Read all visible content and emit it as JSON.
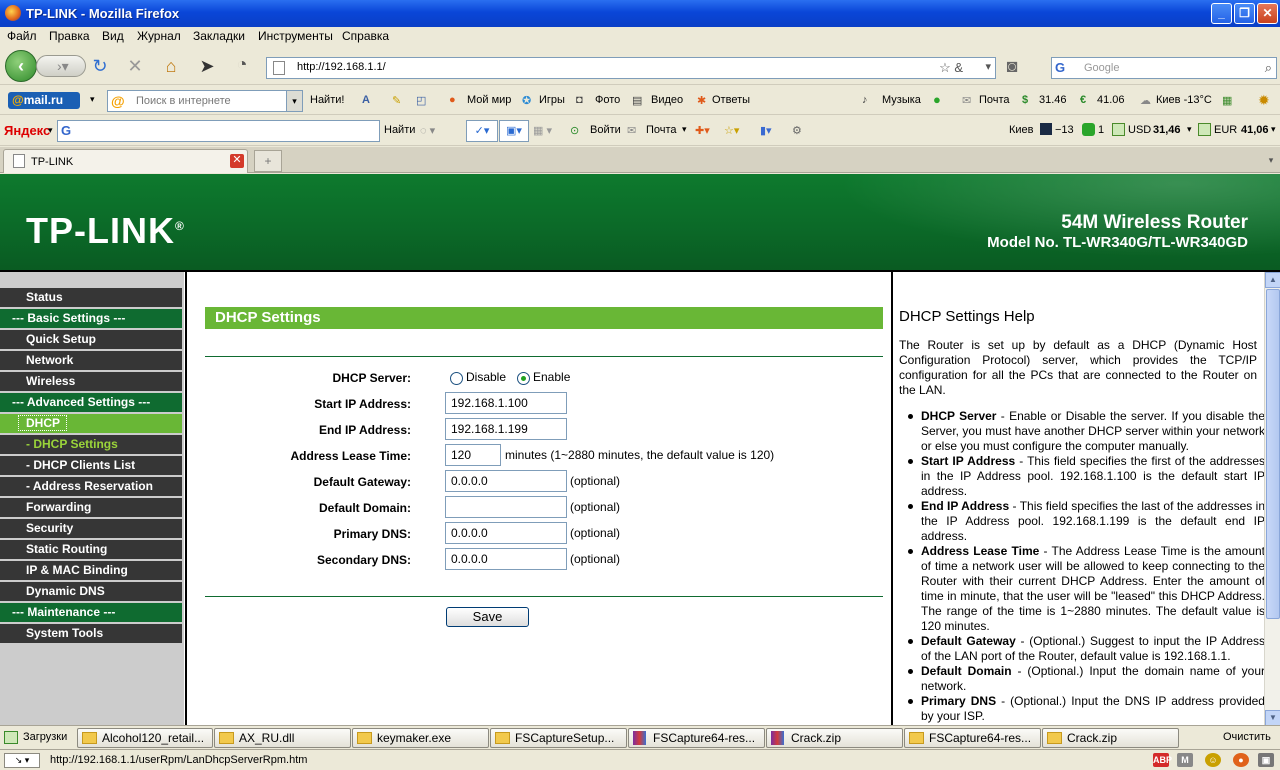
{
  "window": {
    "title": "TP-LINK - Mozilla Firefox"
  },
  "menubar": [
    "Файл",
    "Правка",
    "Вид",
    "Журнал",
    "Закладки",
    "Инструменты",
    "Справка"
  ],
  "nav": {
    "url": "http://192.168.1.1/",
    "search_placeholder": "Google"
  },
  "mailbar": {
    "logo": "mail.ru",
    "search_placeholder": "Поиск в интернете",
    "find": "Найти!",
    "links": [
      "Мой мир",
      "Игры",
      "Фото",
      "Видео",
      "Ответы",
      "Музыка",
      "Почта",
      "31.46",
      "41.06",
      "Киев -13°C"
    ]
  },
  "yabar": {
    "logo": "Яндекс",
    "find": "Найти",
    "login": "Войти",
    "mail": "Почта",
    "city": "Киев",
    "temp": "−13",
    "count": "1",
    "usd_label": "USD",
    "usd": "31,46",
    "eur_label": "EUR",
    "eur": "41,06"
  },
  "tab": {
    "label": "TP-LINK"
  },
  "banner": {
    "logo": "TP-LINK",
    "product": "54M Wireless Router",
    "model": "Model No. TL-WR340G/TL-WR340GD"
  },
  "sidebar": {
    "items": [
      {
        "label": "Status",
        "kind": "dark"
      },
      {
        "label": "--- Basic Settings ---",
        "kind": "sec"
      },
      {
        "label": "Quick Setup",
        "kind": "dark"
      },
      {
        "label": "Network",
        "kind": "dark"
      },
      {
        "label": "Wireless",
        "kind": "dark"
      },
      {
        "label": "--- Advanced Settings ---",
        "kind": "sec"
      },
      {
        "label": "DHCP",
        "kind": "sel"
      },
      {
        "label": "- DHCP Settings",
        "kind": "subsel"
      },
      {
        "label": "- DHCP Clients List",
        "kind": "sub"
      },
      {
        "label": "- Address Reservation",
        "kind": "sub"
      },
      {
        "label": "Forwarding",
        "kind": "dark"
      },
      {
        "label": "Security",
        "kind": "dark"
      },
      {
        "label": "Static Routing",
        "kind": "dark"
      },
      {
        "label": "IP & MAC Binding",
        "kind": "dark"
      },
      {
        "label": "Dynamic DNS",
        "kind": "dark"
      },
      {
        "label": "--- Maintenance ---",
        "kind": "sec"
      },
      {
        "label": "System Tools",
        "kind": "dark"
      }
    ]
  },
  "form": {
    "title": "DHCP Settings",
    "server_label": "DHCP Server:",
    "disable": "Disable",
    "enable": "Enable",
    "start_label": "Start IP Address:",
    "start_value": "192.168.1.100",
    "end_label": "End IP Address:",
    "end_value": "192.168.1.199",
    "lease_label": "Address Lease Time:",
    "lease_value": "120",
    "lease_hint": "minutes (1~2880 minutes, the default value is 120)",
    "gateway_label": "Default Gateway:",
    "gateway_value": "0.0.0.0",
    "domain_label": "Default Domain:",
    "domain_value": "",
    "pdns_label": "Primary DNS:",
    "pdns_value": "0.0.0.0",
    "sdns_label": "Secondary DNS:",
    "sdns_value": "0.0.0.0",
    "optional": "(optional)",
    "save": "Save"
  },
  "help": {
    "title": "DHCP Settings Help",
    "intro": "The Router is set up by default as a DHCP (Dynamic Host Configuration Protocol) server, which provides the TCP/IP configuration for all the PCs that are connected to the Router on the LAN.",
    "items": [
      {
        "term": "DHCP Server",
        "text": " - Enable or Disable the server. If you disable the Server, you must have another DHCP server within your network or else you must configure the computer manually."
      },
      {
        "term": "Start IP Address",
        "text": " - This field specifies the first of the addresses in the IP Address pool. 192.168.1.100 is the default start IP address."
      },
      {
        "term": "End IP Address",
        "text": " - This field specifies the last of the addresses in the IP Address pool. 192.168.1.199 is the default end IP address."
      },
      {
        "term": "Address Lease Time",
        "text": " - The Address Lease Time is the amount of time a network user will be allowed to keep connecting to the Router with their current DHCP Address. Enter the amount of time in minute, that the user will be \"leased\" this DHCP Address. The range of the time is 1~2880 minutes. The default value is 120 minutes."
      },
      {
        "term": "Default Gateway",
        "text": " - (Optional.) Suggest to input the IP Address of the LAN port of the Router, default value is 192.168.1.1."
      },
      {
        "term": "Default Domain",
        "text": " - (Optional.) Input the domain name of your network."
      },
      {
        "term": "Primary DNS",
        "text": " - (Optional.) Input the DNS IP address provided by your ISP."
      }
    ]
  },
  "downloads": {
    "label": "Загрузки",
    "items": [
      "Alcohol120_retail...",
      "AX_RU.dll",
      "keymaker.exe",
      "FSCaptureSetup...",
      "FSCapture64-res...",
      "Crack.zip",
      "FSCapture64-res...",
      "Crack.zip"
    ],
    "clear": "Очистить"
  },
  "status": {
    "url": "http://192.168.1.1/userRpm/LanDhcpServerRpm.htm"
  }
}
